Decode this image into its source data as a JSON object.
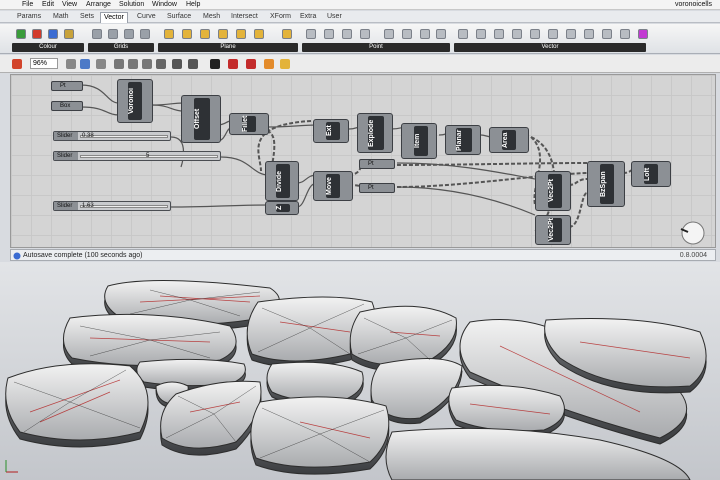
{
  "menu": [
    "File",
    "Edit",
    "View",
    "Arrange",
    "Solution",
    "Window",
    "Help"
  ],
  "doc_title": "voronoicells",
  "tabs": [
    "Params",
    "Math",
    "Sets",
    "Vector",
    "Curve",
    "Surface",
    "Mesh",
    "Intersect",
    "XForm",
    "Extra",
    "User"
  ],
  "active_tab": "Vector",
  "ribbon_groups": [
    "Colour",
    "Grids",
    "Plane",
    "Point",
    "Vector"
  ],
  "zoom": "96%",
  "components": {
    "pt": "Pt",
    "box": "Box",
    "voronoi": "Voronoi",
    "offset": "Offset",
    "fillet": "Fillet",
    "ext": "Ext",
    "explode": "Explode",
    "item": "Item",
    "planar": "Planar",
    "area": "Area",
    "divide": "Divide",
    "z": "Z",
    "move": "Move",
    "pt2": "Pt",
    "pt3": "Pt",
    "vec2pt_a": "Vec2Pt",
    "vec2pt_b": "Vec2Pt",
    "bzspan": "BzSpan",
    "loft": "Loft"
  },
  "sliders": [
    {
      "label": "Slider",
      "value": "0.38"
    },
    {
      "label": "Slider",
      "value": "5"
    },
    {
      "label": "Slider",
      "value": "1.63"
    }
  ],
  "status": "Autosave complete (100 seconds ago)",
  "version": "0.8.0004"
}
